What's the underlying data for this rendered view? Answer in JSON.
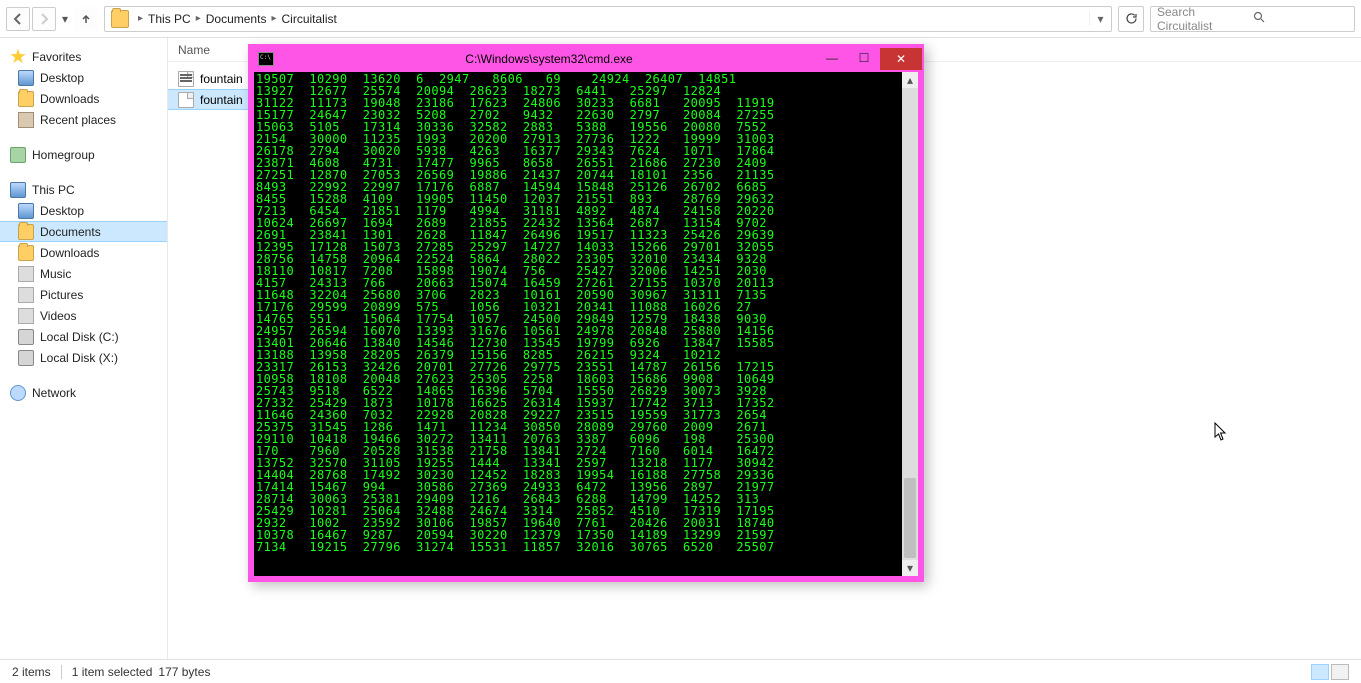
{
  "toolbar": {
    "breadcrumb": [
      "This PC",
      "Documents",
      "Circuitalist"
    ],
    "search_placeholder": "Search Circuitalist"
  },
  "nav": {
    "favorites": {
      "label": "Favorites",
      "children": [
        "Desktop",
        "Downloads",
        "Recent places"
      ]
    },
    "homegroup": {
      "label": "Homegroup"
    },
    "thispc": {
      "label": "This PC",
      "children": [
        "Desktop",
        "Documents",
        "Downloads",
        "Music",
        "Pictures",
        "Videos",
        "Local Disk (C:)",
        "Local Disk (X:)"
      ]
    },
    "network": {
      "label": "Network"
    }
  },
  "content": {
    "col_head": "Name",
    "files": [
      "fountain",
      "fountain"
    ]
  },
  "status": {
    "items": "2 items",
    "selected": "1 item selected",
    "bytes": "177 bytes"
  },
  "cmd": {
    "title": "C:\\Windows\\system32\\cmd.exe",
    "lines": [
      "19507  10290  13620  6  2947   8606   69    24924  26407  14851",
      "13927  12677  25574  20094  28623  18273  6441   25297  12824",
      "31122  11173  19048  23186  17623  24806  30233  6681   20095  11919",
      "15177  24647  23032  5208   2702   9432   22630  2797   20084  27255",
      "15063  5105   17314  30336  32582  2883   5388   19556  20080  7552",
      "2154   30000  11235  1993   20200  27913  27736  1222   19999  31003",
      "26178  2794   30020  5938   4263   16377  29343  7624   1071   17864",
      "23871  4608   4731   17477  9965   8658   26551  21686  27230  2409",
      "27251  12870  27053  26569  19886  21437  20744  18101  2356   21135",
      "8493   22992  22997  17176  6887   14594  15848  25126  26702  6685",
      "8455   15288  4109   19905  11450  12037  21551  893    28769  29632",
      "7213   6454   21851  1179   4994   31181  4892   4874   24158  20220",
      "10624  26697  1694   2689   21855  22432  13564  2687   13154  9702",
      "2691   23841  1301   2628   11847  26496  19517  11323  25426  29639",
      "12395  17128  15073  27285  25297  14727  14033  15266  29701  32055",
      "28756  14758  20964  22524  5864   28022  23305  32010  23434  9328",
      "18110  10817  7208   15898  19074  756    25427  32006  14251  2030",
      "4157   24313  766    20663  15074  16459  27261  27155  10370  20113",
      "11648  32204  25680  3706   2823   10161  20590  30967  31311  7135",
      "17176  29599  20899  575    1056   10321  20341  11088  16026  27",
      "14765  551    15064  17754  1057   24500  29849  12579  18438  9030",
      "24957  26594  16070  13393  31676  10561  24978  20848  25880  14156",
      "13401  20646  13840  14546  12730  13545  19799  6926   13847  15585",
      "13188  13958  28205  26379  15156  8285   26215  9324   10212",
      "23317  26153  32426  20701  27726  29775  23551  14787  26156  17215",
      "10958  18108  20048  27623  25305  2258   18603  15686  9908   10649",
      "25743  9518   6522   14865  16396  5704   15550  26829  30073  3928",
      "27332  25429  1873   10178  16625  26314  15937  17742  3713   17352",
      "11646  24360  7032   22928  20828  29227  23515  19559  31773  2654",
      "25375  31545  1286   1471   11234  30850  28089  29760  2009   2671",
      "29110  10418  19466  30272  13411  20763  3387   6096   198    25300",
      "170    7960   20528  31538  21758  13841  2724   7160   6014   16472",
      "13752  32570  31105  19255  1444   13341  2597   13218  1177   30942",
      "14404  28768  17492  30230  12452  18283  19954  16188  27758  29336",
      "17414  15467  994    30586  27369  24933  6472   13956  2897   21977",
      "28714  30063  25381  29409  1216   26843  6288   14799  14252  313",
      "25429  10281  25064  32488  24674  3314   25852  4510   17319  17195",
      "2932   1002   23592  30106  19857  19640  7761   20426  20031  18740",
      "10378  16467  9287   20594  30220  12379  17350  14189  13299  21597",
      "7134   19215  27796  31274  15531  11857  32016  30765  6520   25507"
    ]
  }
}
